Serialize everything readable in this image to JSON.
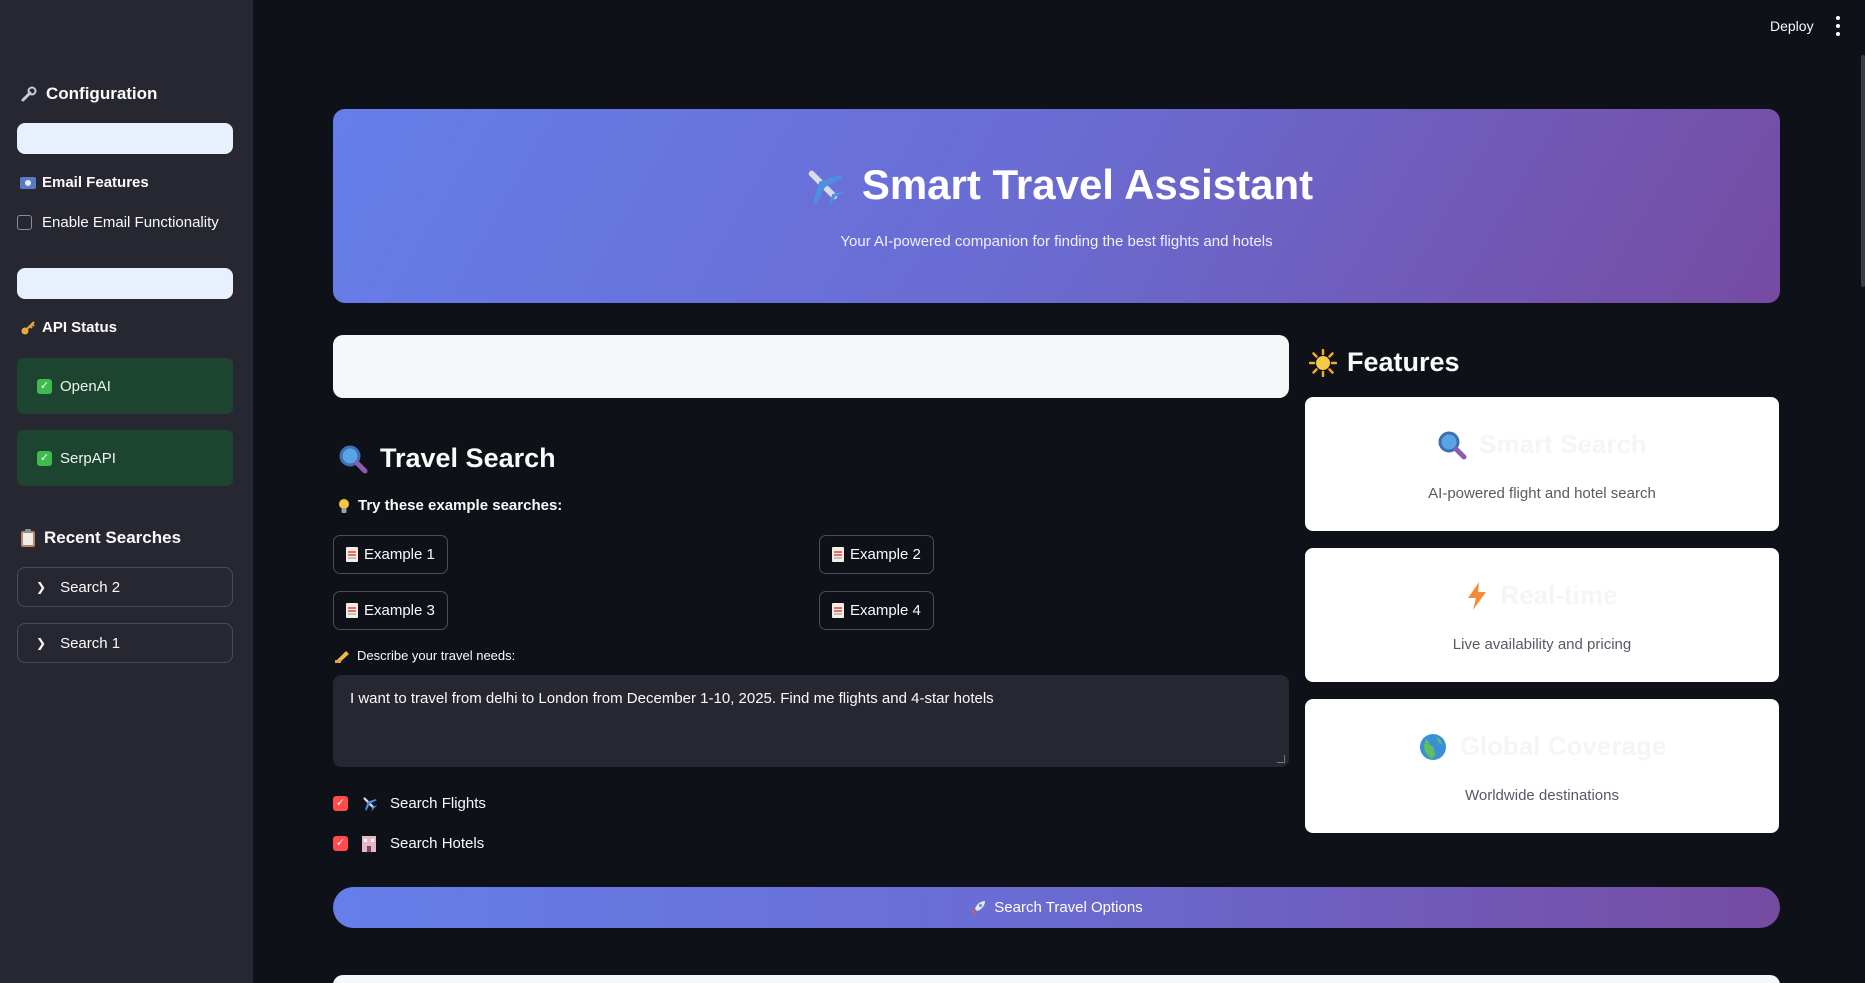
{
  "topbar": {
    "deploy_label": "Deploy"
  },
  "sidebar": {
    "configuration_title": "Configuration",
    "email_features_label": "Email Features",
    "enable_email_label": "Enable Email Functionality",
    "api_status_label": "API Status",
    "api_statuses": [
      {
        "label": "OpenAI",
        "status": "ok"
      },
      {
        "label": "SerpAPI",
        "status": "ok"
      }
    ],
    "recent_searches_title": "Recent Searches",
    "recent_searches": [
      {
        "label": "Search 2"
      },
      {
        "label": "Search 1"
      }
    ]
  },
  "hero": {
    "title": "Smart Travel Assistant",
    "subtitle": "Your AI-powered companion for finding the best flights and hotels"
  },
  "travel_search": {
    "title": "Travel Search",
    "tip_label": "Try these example searches:",
    "examples": [
      "Example 1",
      "Example 2",
      "Example 3",
      "Example 4"
    ],
    "describe_label": "Describe your travel needs:",
    "query_value": "I want to travel from delhi to London from December 1-10, 2025. Find me flights and 4-star hotels",
    "search_flights_label": "Search Flights",
    "search_flights_checked": true,
    "search_hotels_label": "Search Hotels",
    "search_hotels_checked": true,
    "submit_label": "Search Travel Options"
  },
  "features": {
    "title": "Features",
    "cards": [
      {
        "title": "Smart Search",
        "description": "AI-powered flight and hotel search",
        "icon": "magnifier-icon"
      },
      {
        "title": "Real-time",
        "description": "Live availability and pricing",
        "icon": "lightning-icon"
      },
      {
        "title": "Global Coverage",
        "description": "Worldwide destinations",
        "icon": "globe-icon"
      }
    ]
  },
  "colors": {
    "background": "#0e1117",
    "sidebar": "#262730",
    "accent_start": "#667eea",
    "accent_end": "#764ba2",
    "status_ok": "#1d4430",
    "checkbox_checked": "#ff4b4b"
  }
}
